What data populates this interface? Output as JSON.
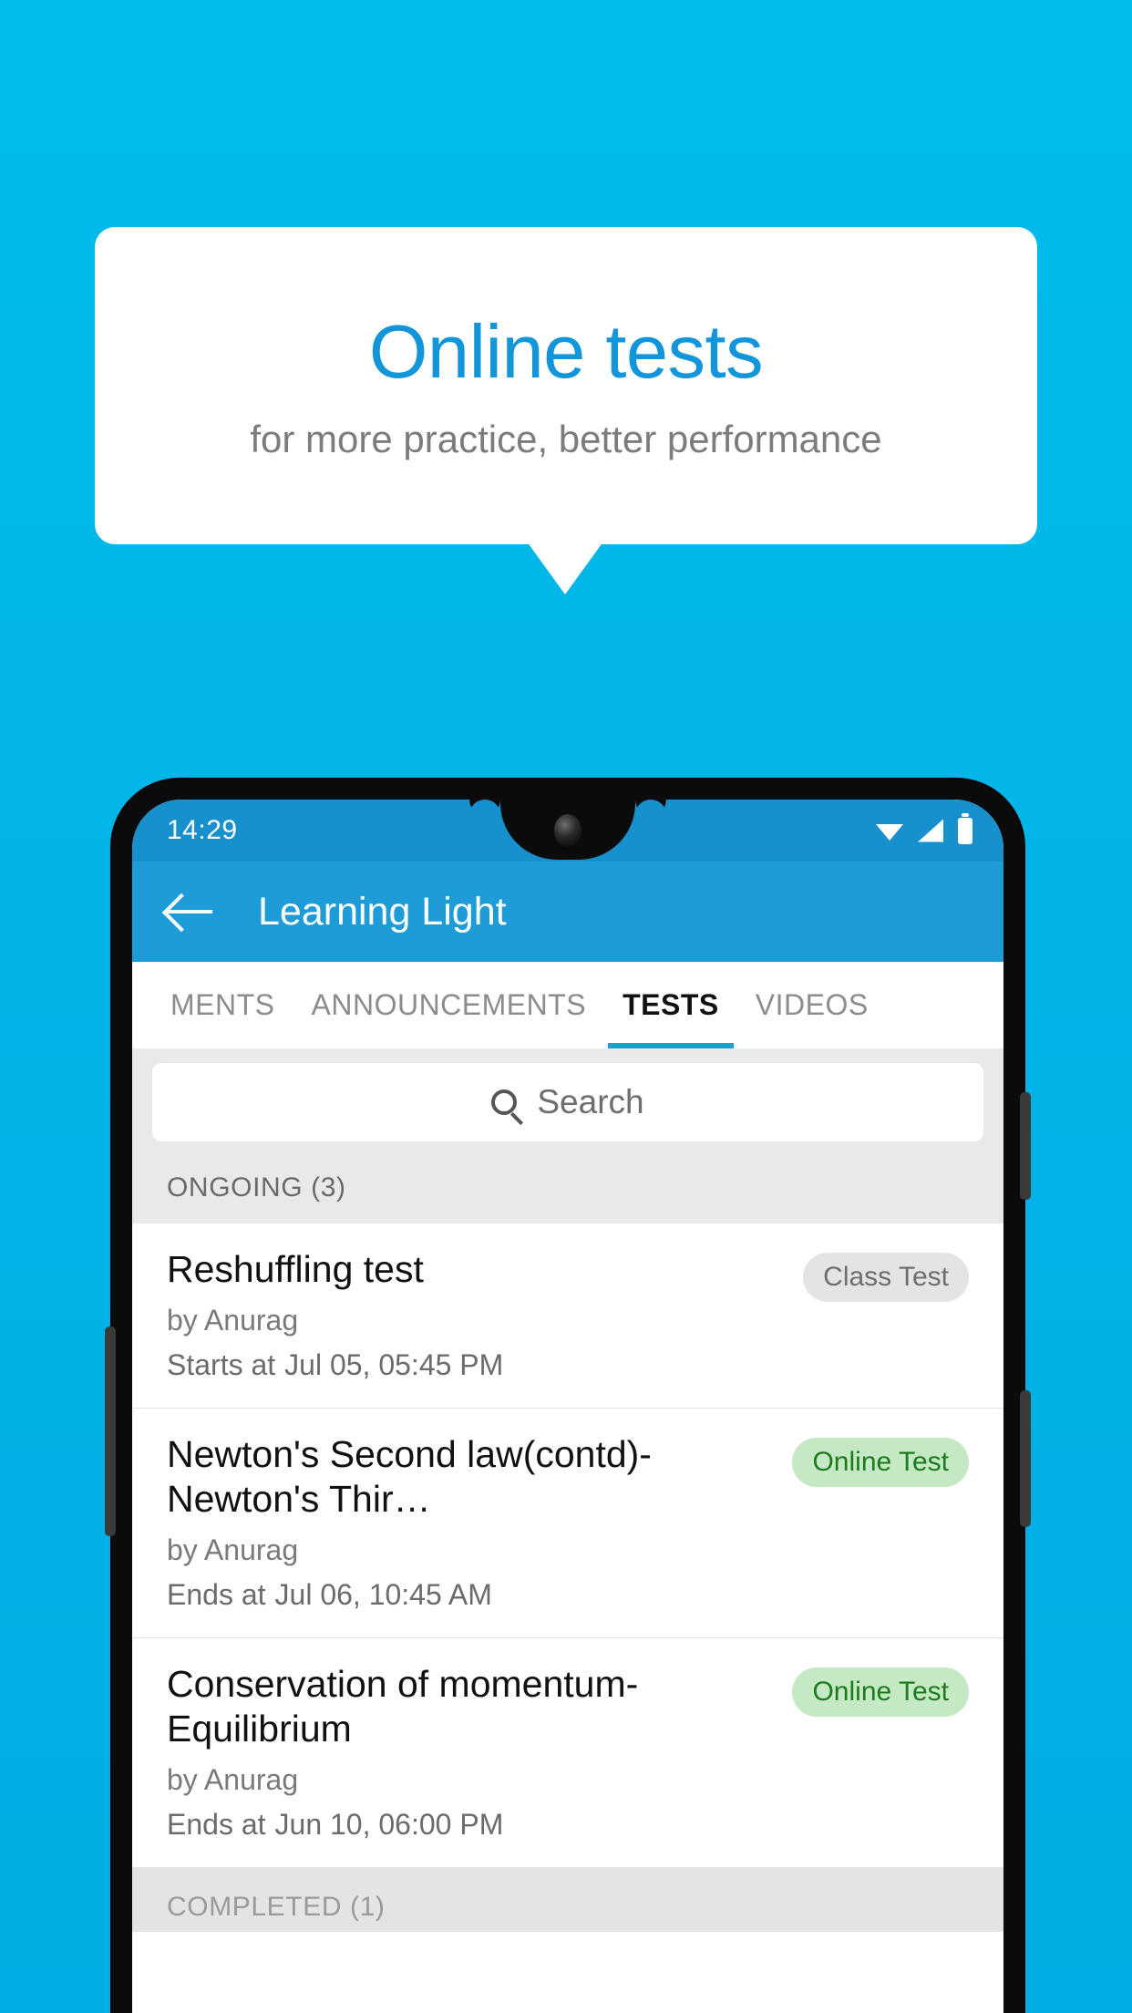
{
  "promo": {
    "title": "Online tests",
    "subtitle": "for more practice, better performance"
  },
  "colors": {
    "background": "#00BCEC",
    "promo_title": "#1395DA",
    "appbar": "#1D9CD8",
    "statusbar": "#1790CE",
    "tab_active": "#1D9CD8",
    "badge_online_bg": "#C5E8C5",
    "badge_online_text": "#1C7C1C",
    "badge_class_bg": "#E4E4E4",
    "badge_class_text": "#6E6E6E"
  },
  "phone": {
    "status_bar": {
      "time": "14:29",
      "icons": [
        "wifi-icon",
        "signal-icon",
        "battery-icon"
      ]
    },
    "app_bar": {
      "back_icon": "back-arrow-icon",
      "title": "Learning Light"
    },
    "tabs": [
      {
        "label": "MENTS",
        "active": false
      },
      {
        "label": "ANNOUNCEMENTS",
        "active": false
      },
      {
        "label": "TESTS",
        "active": true
      },
      {
        "label": "VIDEOS",
        "active": false
      }
    ],
    "search": {
      "icon": "search-icon",
      "placeholder": "Search",
      "value": ""
    },
    "sections": [
      {
        "label": "ONGOING (3)"
      },
      {
        "label": "COMPLETED (1)"
      }
    ],
    "tests": [
      {
        "title": "Reshuffling test",
        "badge": "Class Test",
        "badge_type": "gray",
        "author": "by Anurag",
        "when_label": "Starts at",
        "when_value": "Jul 05, 05:45 PM"
      },
      {
        "title": "Newton's Second law(contd)-Newton's Thir…",
        "badge": "Online Test",
        "badge_type": "green",
        "author": "by Anurag",
        "when_label": "Ends at",
        "when_value": "Jul 06, 10:45 AM"
      },
      {
        "title": "Conservation of momentum-Equilibrium",
        "badge": "Online Test",
        "badge_type": "green",
        "author": "by Anurag",
        "when_label": "Ends at",
        "when_value": "Jun 10, 06:00 PM"
      }
    ]
  }
}
